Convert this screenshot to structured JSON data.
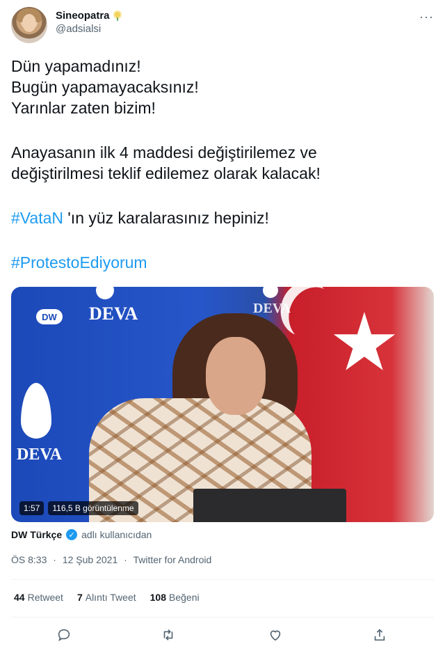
{
  "author": {
    "display_name": "Sineopatra",
    "handle": "@adsialsi"
  },
  "tweet": {
    "lines": [
      "Dün yapamadınız!",
      "Bugün yapamayacaksınız!",
      "Yarınlar zaten bizim!",
      "",
      "Anayasanın ilk 4 maddesi değiştirilemez ve",
      "değiştirilmesi teklif edilemez olarak kalacak!",
      "",
      "'ın yüz karalarasınız hepiniz!",
      ""
    ],
    "hashtag_1": "#VataN",
    "hashtag_2": "#ProtestoEdiyorum"
  },
  "media": {
    "duration": "1:57",
    "views": "116,5 B görüntülenme",
    "logo_text": "DW",
    "banner_text": "DEVA"
  },
  "source": {
    "name": "DW Türkçe",
    "suffix": "adlı kullanıcıdan"
  },
  "meta": {
    "time": "ÖS 8:33",
    "date": "12 Şub 2021",
    "separator": "·",
    "client": "Twitter for Android"
  },
  "stats": {
    "retweets_count": "44",
    "retweets_label": "Retweet",
    "quotes_count": "7",
    "quotes_label": "Alıntı Tweet",
    "likes_count": "108",
    "likes_label": "Beğeni"
  },
  "colors": {
    "accent": "#1d9bf0",
    "text": "#0f1419",
    "muted": "#536471"
  },
  "icons": {
    "reply": "reply-icon",
    "retweet": "retweet-icon",
    "like": "like-icon",
    "share": "share-icon",
    "more": "more-icon",
    "verified": "verified-icon"
  }
}
